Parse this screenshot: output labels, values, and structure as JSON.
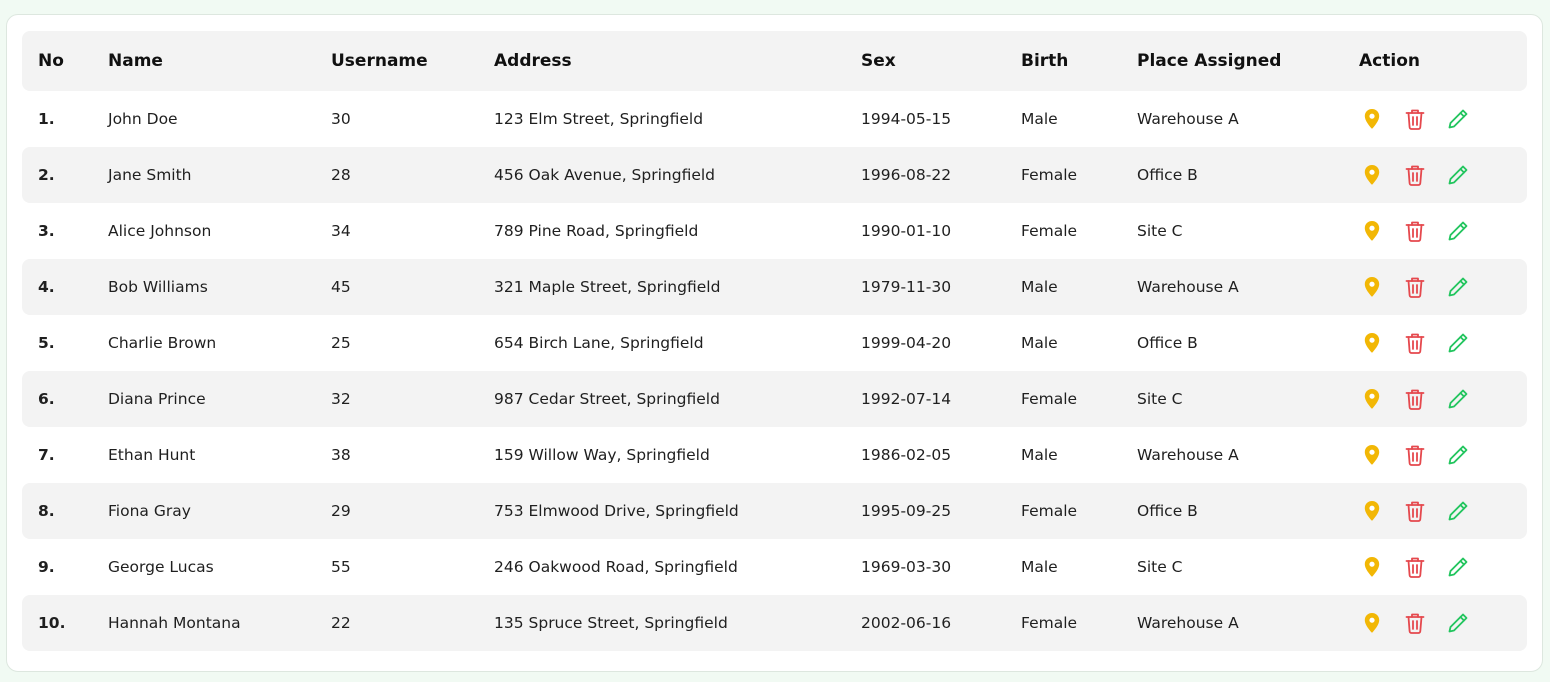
{
  "table": {
    "headers": {
      "no": "No",
      "name": "Name",
      "username": "Username",
      "address": "Address",
      "sex": "Sex",
      "birth": "Birth",
      "place": "Place Assigned",
      "action": "Action"
    },
    "rows": [
      {
        "no": "1.",
        "name": "John Doe",
        "username": "30",
        "address": "123 Elm Street, Springfield",
        "sex": "1994-05-15",
        "birth": "Male",
        "place": "Warehouse A"
      },
      {
        "no": "2.",
        "name": "Jane Smith",
        "username": "28",
        "address": "456 Oak Avenue, Springfield",
        "sex": "1996-08-22",
        "birth": "Female",
        "place": "Office B"
      },
      {
        "no": "3.",
        "name": "Alice Johnson",
        "username": "34",
        "address": "789 Pine Road, Springfield",
        "sex": "1990-01-10",
        "birth": "Female",
        "place": "Site C"
      },
      {
        "no": "4.",
        "name": "Bob Williams",
        "username": "45",
        "address": "321 Maple Street, Springfield",
        "sex": "1979-11-30",
        "birth": "Male",
        "place": "Warehouse A"
      },
      {
        "no": "5.",
        "name": "Charlie Brown",
        "username": "25",
        "address": "654 Birch Lane, Springfield",
        "sex": "1999-04-20",
        "birth": "Male",
        "place": "Office B"
      },
      {
        "no": "6.",
        "name": "Diana Prince",
        "username": "32",
        "address": "987 Cedar Street, Springfield",
        "sex": "1992-07-14",
        "birth": "Female",
        "place": "Site C"
      },
      {
        "no": "7.",
        "name": "Ethan Hunt",
        "username": "38",
        "address": "159 Willow Way, Springfield",
        "sex": "1986-02-05",
        "birth": "Male",
        "place": "Warehouse A"
      },
      {
        "no": "8.",
        "name": "Fiona Gray",
        "username": "29",
        "address": "753 Elmwood Drive, Springfield",
        "sex": "1995-09-25",
        "birth": "Female",
        "place": "Office B"
      },
      {
        "no": "9.",
        "name": "George Lucas",
        "username": "55",
        "address": "246 Oakwood Road, Springfield",
        "sex": "1969-03-30",
        "birth": "Male",
        "place": "Site C"
      },
      {
        "no": "10.",
        "name": "Hannah Montana",
        "username": "22",
        "address": "135 Spruce Street, Springfield",
        "sex": "2002-06-16",
        "birth": "Female",
        "place": "Warehouse A"
      }
    ],
    "row_actions": [
      "location-pin-icon",
      "trash-icon",
      "pencil-icon"
    ]
  },
  "colors": {
    "pin": "#f2b705",
    "trash": "#e5484d",
    "pencil": "#22c55e",
    "header_bg": "#f3f3f3",
    "alt_row_bg": "#f3f3f3",
    "page_bg": "#f1faf3"
  }
}
